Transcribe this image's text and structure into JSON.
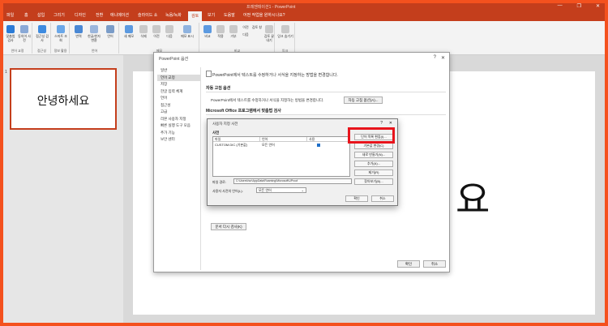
{
  "app": {
    "title": "프레젠테이션1 - PowerPoint",
    "window_controls": [
      "—",
      "❐",
      "✕"
    ]
  },
  "tabs": [
    "파일",
    "홈",
    "삽입",
    "그리기",
    "디자인",
    "전환",
    "애니메이션",
    "슬라이드 쇼",
    "녹음/녹화",
    "검토",
    "보기",
    "도움말",
    "어떤 작업을 원하시나요?"
  ],
  "active_tab_index": 9,
  "ribbon": {
    "groups": [
      {
        "label": "언어 교정",
        "buttons": [
          "맞춤법 검사",
          "동의어 사전"
        ]
      },
      {
        "label": "접근성",
        "buttons": [
          "접근성 검사"
        ]
      },
      {
        "label": "정보 활용",
        "buttons": [
          "스마트 조회"
        ]
      },
      {
        "label": "언어",
        "buttons": [
          "번역",
          "한글/한자 변환",
          "언어"
        ]
      },
      {
        "label": "메모",
        "buttons": [
          "새 메모",
          "삭제",
          "이전",
          "다음",
          "메모 표시"
        ]
      },
      {
        "label": "비교",
        "buttons": [
          "비교",
          "적용",
          "거부",
          "이전",
          "다음",
          "검토 창",
          "검토 끝내기"
        ]
      },
      {
        "label": "잉크",
        "buttons": [
          "잉크 숨기기"
        ]
      }
    ]
  },
  "slide_panel": {
    "slide_number": "1",
    "thumbnail_text": "안녕하세요"
  },
  "slide_visible_char": "요",
  "options_dialog": {
    "title": "PowerPoint 옵션",
    "help": "?",
    "close": "✕",
    "nav": [
      "일반",
      "언어 교정",
      "저장",
      "한글 입력 체계",
      "언어",
      "접근성",
      "고급",
      "리본 사용자 지정",
      "빠른 실행 도구 모음",
      "추가 기능",
      "보안 센터"
    ],
    "selected_nav_index": 1,
    "intro": "PowerPoint에서 텍스트를 수정하거나 서식을 지정하는 방법을 변경합니다.",
    "autocorrect_section": "자동 고침 옵션",
    "autocorrect_desc": "PowerPoint에서 텍스트를 수정하거나 서식을 지정하는 방법을 변경합니다.",
    "autocorrect_button": "자동 고침 옵션(A)...",
    "spellcheck_section": "Microsoft Office 프로그램에서 맞춤법 검사",
    "recheck_button": "문서 다시 검사(K)",
    "ok": "확인",
    "cancel": "취소"
  },
  "custom_dict_dialog": {
    "title": "사용자 지정 사전",
    "help": "?",
    "close": "✕",
    "label": "사전",
    "columns": [
      "파일",
      "언어",
      "사용"
    ],
    "rows": [
      {
        "file": "CUSTOM.DIC (기본값)",
        "language": "모든 언어",
        "enabled": true
      }
    ],
    "buttons": [
      "단어 목록 편집(I)...",
      "기본값 변경(C)",
      "새로 만들기(N)...",
      "추가(A)...",
      "제거(R)",
      "찾아보기(B)..."
    ],
    "path_label": "파일 경로:",
    "path_value": "C:\\Users\\hor\\AppData\\Roaming\\Microsoft\\UProof",
    "language_label": "사용자 사전의 언어(L):",
    "language_value": "모든 언어",
    "ok": "확인",
    "cancel": "취소"
  },
  "colors": {
    "brand": "#c43e1c",
    "highlight": "#e8141c",
    "frame": "#f4511e"
  }
}
